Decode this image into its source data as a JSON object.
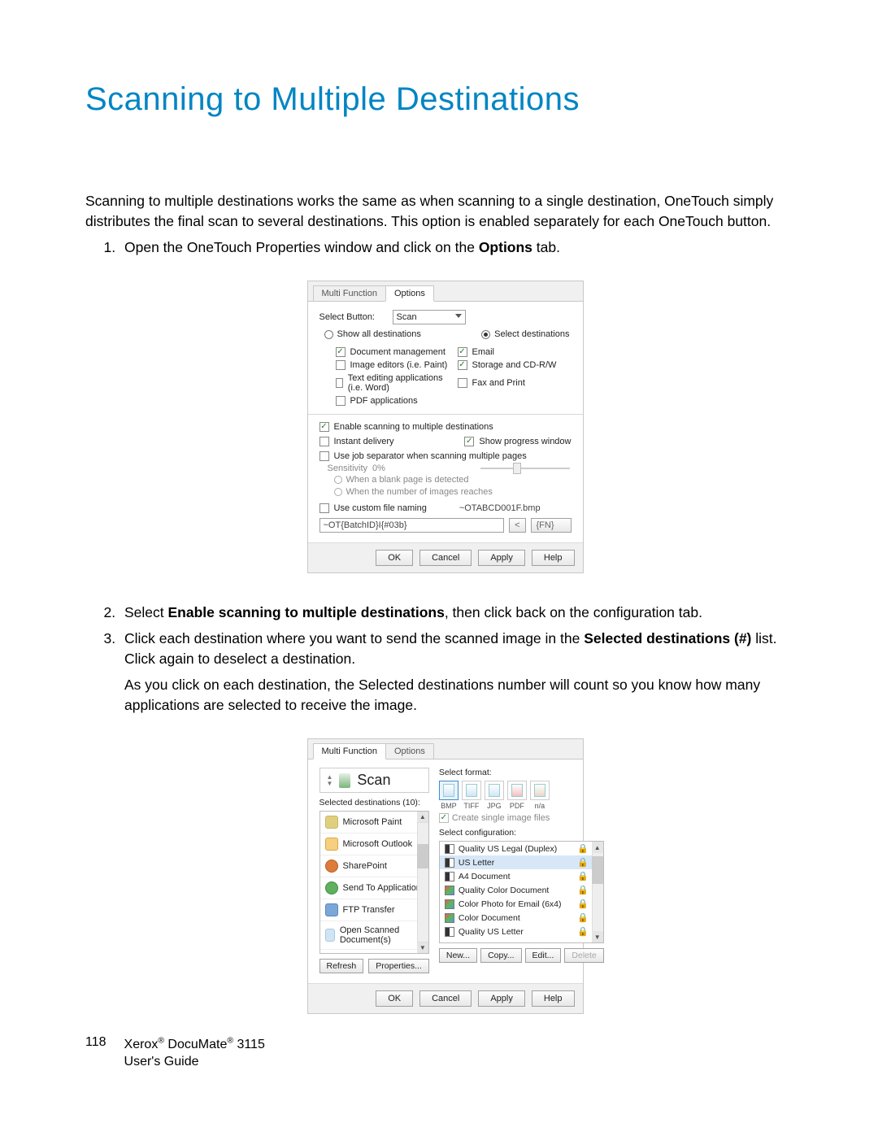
{
  "title": "Scanning to Multiple Destinations",
  "intro": "Scanning to multiple destinations works the same as when scanning to a single destination, OneTouch simply distributes the final scan to several destinations. This option is enabled separately for each OneTouch button.",
  "step1_pre": "Open the OneTouch Properties window and click on the ",
  "step1_bold": "Options",
  "step1_post": " tab.",
  "step2_pre": "Select ",
  "step2_bold": "Enable scanning to multiple destinations",
  "step2_post": ", then click back on the configuration tab.",
  "step3_pre": "Click each destination where you want to send the scanned image in the ",
  "step3_bold": "Selected destinations (#)",
  "step3_post": " list. Click again to deselect a destination.",
  "step3_sub": "As you click on each destination, the Selected destinations number will count so you know how many applications are selected to receive the image.",
  "dlg1": {
    "tabs": {
      "multi": "Multi Function",
      "options": "Options"
    },
    "select_button_label": "Select Button:",
    "select_button_value": "Scan",
    "radio_show_all": "Show all destinations",
    "radio_select": "Select destinations",
    "d_docmgmt": "Document management",
    "d_email": "Email",
    "d_imged": "Image editors (i.e. Paint)",
    "d_storage": "Storage and CD-R/W",
    "d_textapp": "Text editing applications (i.e. Word)",
    "d_fax": "Fax and Print",
    "d_pdf": "PDF applications",
    "c_enable": "Enable scanning to multiple destinations",
    "c_instant": "Instant delivery",
    "c_progress": "Show progress window",
    "c_jobsep": "Use job separator when scanning multiple pages",
    "sens_label": "Sensitivity",
    "sens_val": "0%",
    "r_blank": "When a blank page is detected",
    "r_imgs": "When the number of images reaches",
    "c_custom": "Use custom file naming",
    "preview_name": "~OTABCD001F.bmp",
    "formula": "~OT{BatchID}I{#03b}",
    "btn_less": "<",
    "btn_fn": "{FN}",
    "ok": "OK",
    "cancel": "Cancel",
    "apply": "Apply",
    "help": "Help"
  },
  "dlg2": {
    "tabs": {
      "multi": "Multi Function",
      "options": "Options"
    },
    "scan_title": "Scan",
    "sd_label": "Selected destinations (10):",
    "dest": [
      "Microsoft Paint",
      "Microsoft Outlook",
      "SharePoint",
      "Send To Application",
      "FTP Transfer",
      "Open Scanned Document(s)"
    ],
    "refresh": "Refresh",
    "properties": "Properties...",
    "sf_label": "Select format:",
    "fmts": [
      "BMP",
      "TIFF",
      "JPG",
      "PDF",
      "n/a"
    ],
    "csif": "Create single image files",
    "cfg_label": "Select configuration:",
    "cfgs": [
      "Quality US Legal (Duplex)",
      "US Letter",
      "A4 Document",
      "Quality Color Document",
      "Color Photo for Email (6x4)",
      "Color Document",
      "Quality US Letter"
    ],
    "new": "New...",
    "copy": "Copy...",
    "edit": "Edit...",
    "delete": "Delete",
    "ok": "OK",
    "cancel": "Cancel",
    "apply": "Apply",
    "help": "Help"
  },
  "footer": {
    "page": "118",
    "line1_a": "Xerox",
    "line1_b": " DocuMate",
    "line1_c": " 3115",
    "line2": "User's Guide",
    "reg": "®"
  }
}
